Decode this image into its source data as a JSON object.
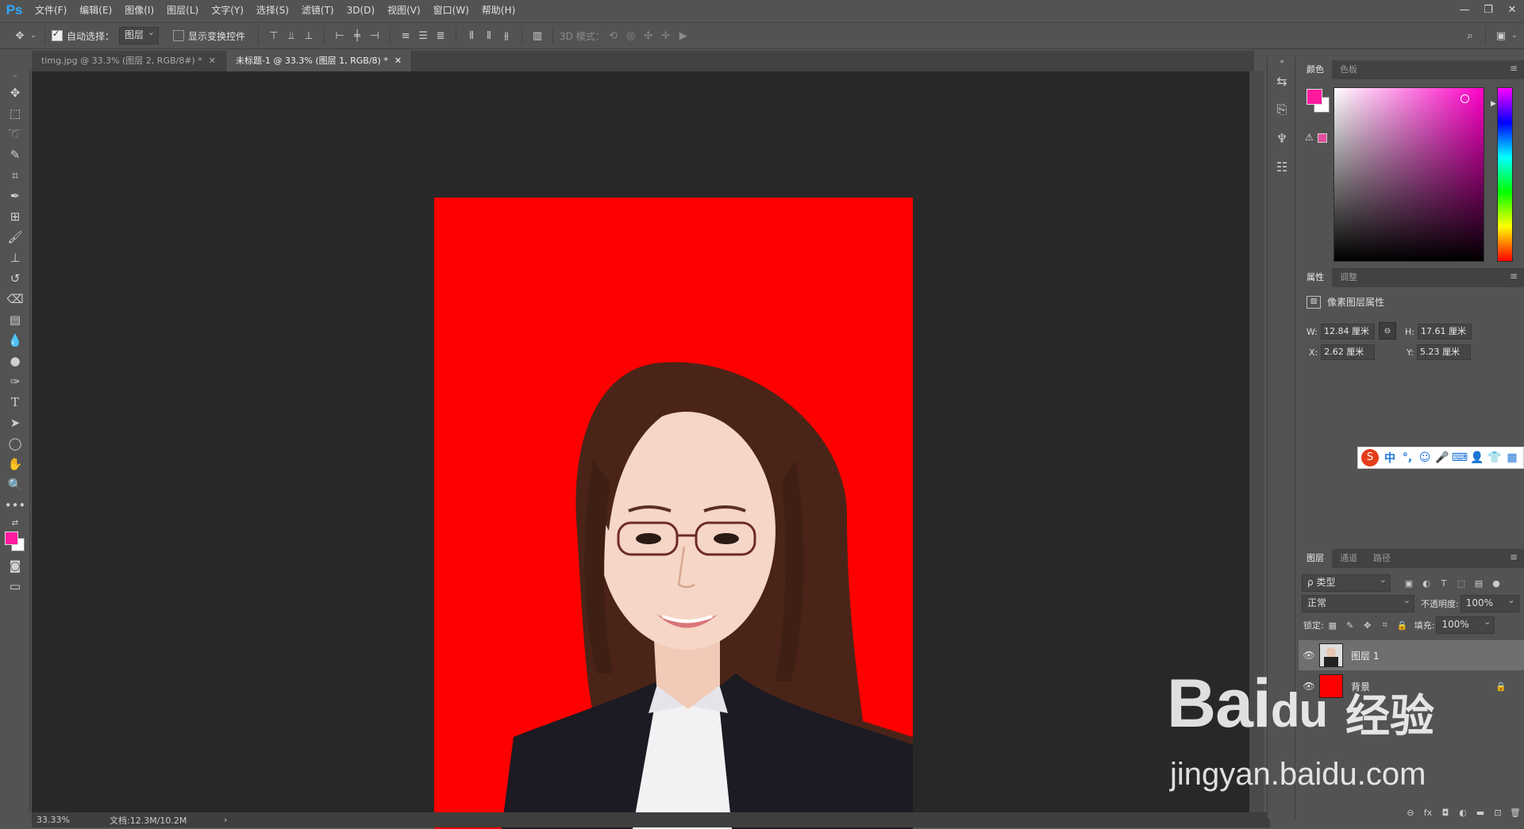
{
  "app": {
    "logo": "Ps"
  },
  "menu": [
    "文件(F)",
    "编辑(E)",
    "图像(I)",
    "图层(L)",
    "文字(Y)",
    "选择(S)",
    "滤镜(T)",
    "3D(D)",
    "视图(V)",
    "窗口(W)",
    "帮助(H)"
  ],
  "window_controls": {
    "minimize": "—",
    "restore": "❐",
    "close": "✕"
  },
  "options": {
    "auto_select_label": "自动选择：",
    "auto_select_checked": true,
    "auto_select_target": "图层",
    "show_transform_label": "显示变换控件",
    "show_transform_checked": false,
    "mode_3d_label": "3D 模式："
  },
  "tabs": [
    {
      "label": "timg.jpg @ 33.3% (图层 2, RGB/8#) *",
      "active": false
    },
    {
      "label": "未标题-1 @ 33.3% (图层 1, RGB/8) *",
      "active": true
    }
  ],
  "status": {
    "zoom": "33.33%",
    "doc_info": "文档:12.3M/10.2M",
    "arrow": "›"
  },
  "color_panel": {
    "tabs": [
      "颜色",
      "色板"
    ],
    "foreground": "#ff1aa0",
    "background": "#ffffff"
  },
  "properties_panel": {
    "tabs": [
      "属性",
      "调整"
    ],
    "title": "像素图层属性",
    "w_label": "W:",
    "w_value": "12.84 厘米",
    "h_label": "H:",
    "h_value": "17.61 厘米",
    "x_label": "X:",
    "x_value": "2.62 厘米",
    "y_label": "Y:",
    "y_value": "5.23 厘米"
  },
  "ime": {
    "logo": "S",
    "items": [
      "中",
      "°,",
      "☺",
      "🎤",
      "⌨",
      "👤",
      "👕",
      "▦"
    ]
  },
  "layers_panel": {
    "tabs": [
      "图层",
      "通道",
      "路径"
    ],
    "filter": "ρ 类型",
    "blend_mode": "正常",
    "opacity_label": "不透明度:",
    "opacity": "100%",
    "lock_label": "锁定:",
    "fill_label": "填充:",
    "fill": "100%",
    "layers": [
      {
        "name": "图层 1",
        "selected": true
      },
      {
        "name": "背景",
        "selected": false
      }
    ]
  },
  "document": {
    "background_color": "#ff0000"
  },
  "watermark": {
    "main": "Bai",
    "main2": "du",
    "cn": "经验",
    "url": "jingyan.baidu.com"
  }
}
